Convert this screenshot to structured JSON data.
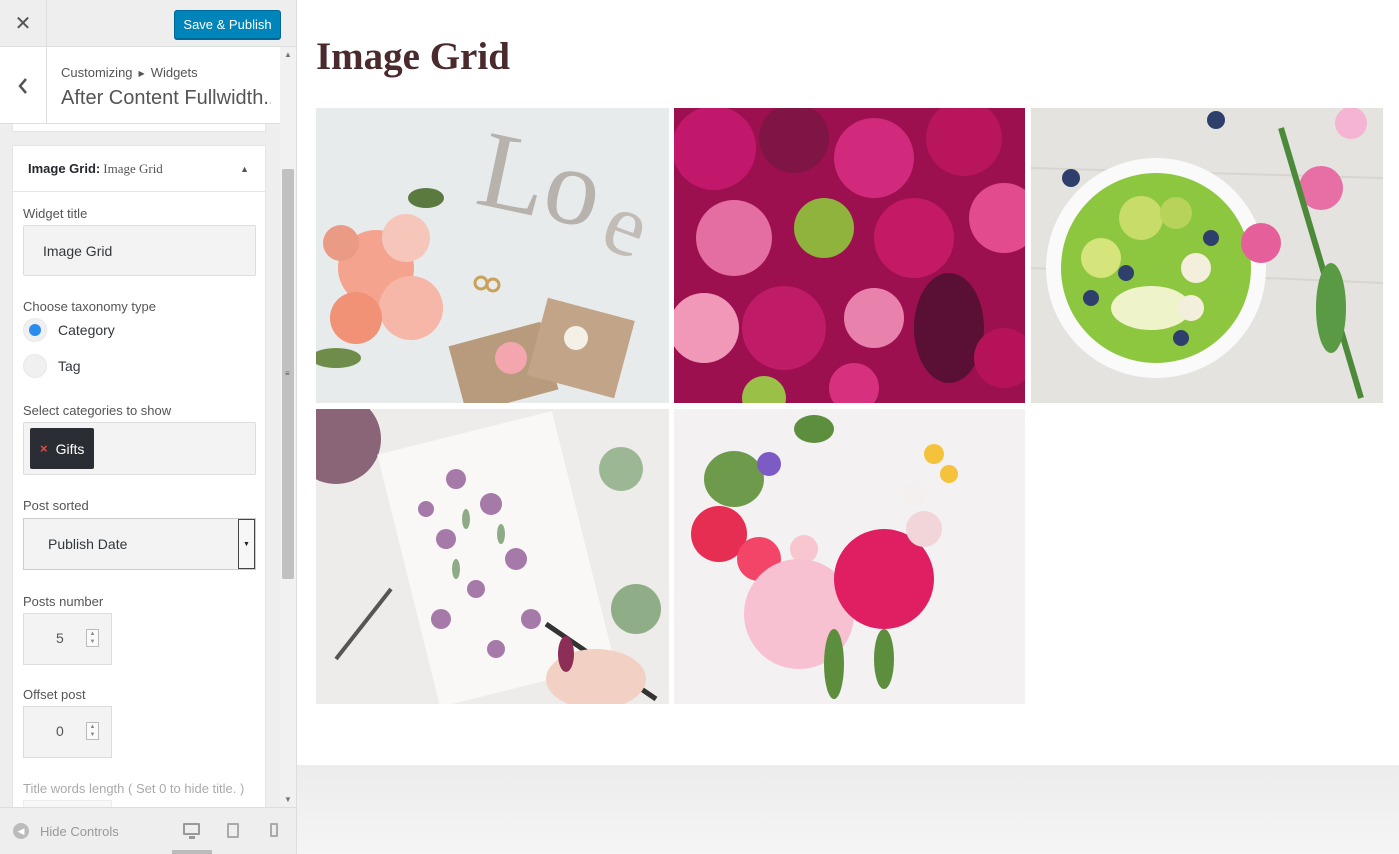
{
  "topbar": {
    "close_icon": "close-icon",
    "publish_label": "Save & Publish",
    "publish_color": "#0085ba"
  },
  "panel": {
    "breadcrumb_root": "Customizing",
    "breadcrumb_section": "Widgets",
    "title": "After Content Fullwidth..."
  },
  "widget": {
    "head_type": "Image Grid:",
    "head_title": "Image Grid",
    "title_label": "Widget title",
    "title_value": "Image Grid",
    "taxonomy_label": "Choose taxonomy type",
    "taxonomy_options": [
      "Category",
      "Tag"
    ],
    "taxonomy_selected": "Category",
    "categories_label": "Select categories to show",
    "selected_category": "Gifts",
    "sort_label": "Post sorted",
    "sort_value": "Publish Date",
    "posts_label": "Posts number",
    "posts_value": "5",
    "offset_label": "Offset post",
    "offset_value": "0",
    "title_words_label": "Title words length ( Set 0 to hide title. )"
  },
  "footer": {
    "hide_controls_label": "Hide Controls"
  },
  "preview": {
    "title": "Image Grid",
    "images": [
      "love-letters-flowers-photo",
      "pink-roses-flowers-photo",
      "smoothie-bowl-flowers-photo",
      "watercolor-painting-photo",
      "flower-heart-photo"
    ]
  }
}
